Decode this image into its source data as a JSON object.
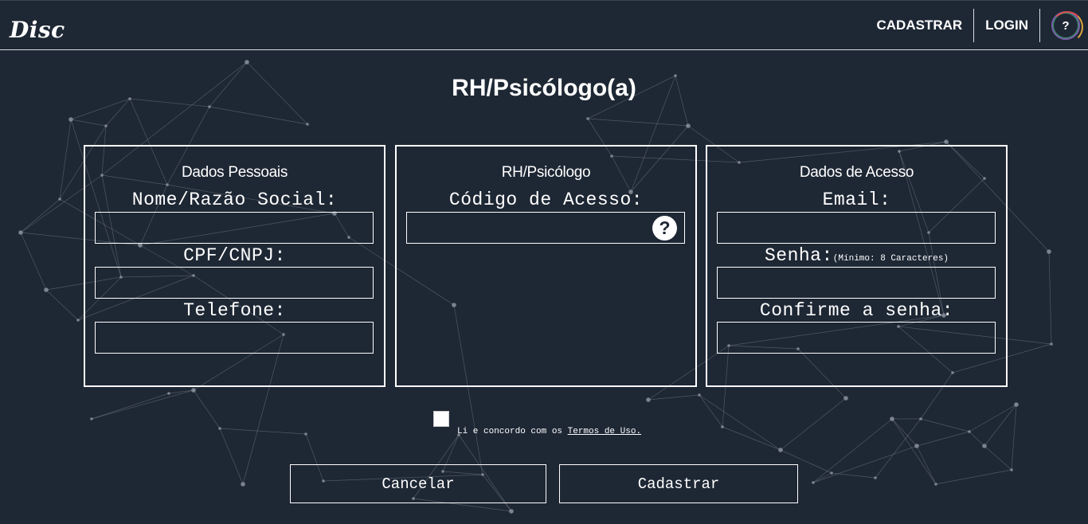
{
  "app": {
    "logo": "Disc"
  },
  "nav": {
    "register": "CADASTRAR",
    "login": "LOGIN",
    "help": "?"
  },
  "page": {
    "title": "RH/Psicólogo(a)"
  },
  "personal": {
    "title": "Dados Pessoais",
    "name_label": "Nome/Razão Social:",
    "name_value": "",
    "cpf_label": "CPF/CNPJ:",
    "cpf_value": "",
    "phone_label": "Telefone:",
    "phone_value": ""
  },
  "hr": {
    "title": "RH/Psicólogo",
    "code_label": "Código de Acesso:",
    "code_value": "",
    "help_icon": "?"
  },
  "access": {
    "title": "Dados de Acesso",
    "email_label": "Email:",
    "email_value": "",
    "password_label": "Senha:",
    "password_note": "(Mínimo: 8 Caracteres)",
    "password_value": "",
    "confirm_label": "Confirme a senha:",
    "confirm_value": ""
  },
  "terms": {
    "text": "Li e concordo com os ",
    "link": "Termos de Uso.",
    "checked": false
  },
  "actions": {
    "cancel": "Cancelar",
    "submit": "Cadastrar"
  },
  "colors": {
    "background": "#1e2734",
    "foreground": "#ffffff",
    "network_lines": "#8a929c"
  }
}
